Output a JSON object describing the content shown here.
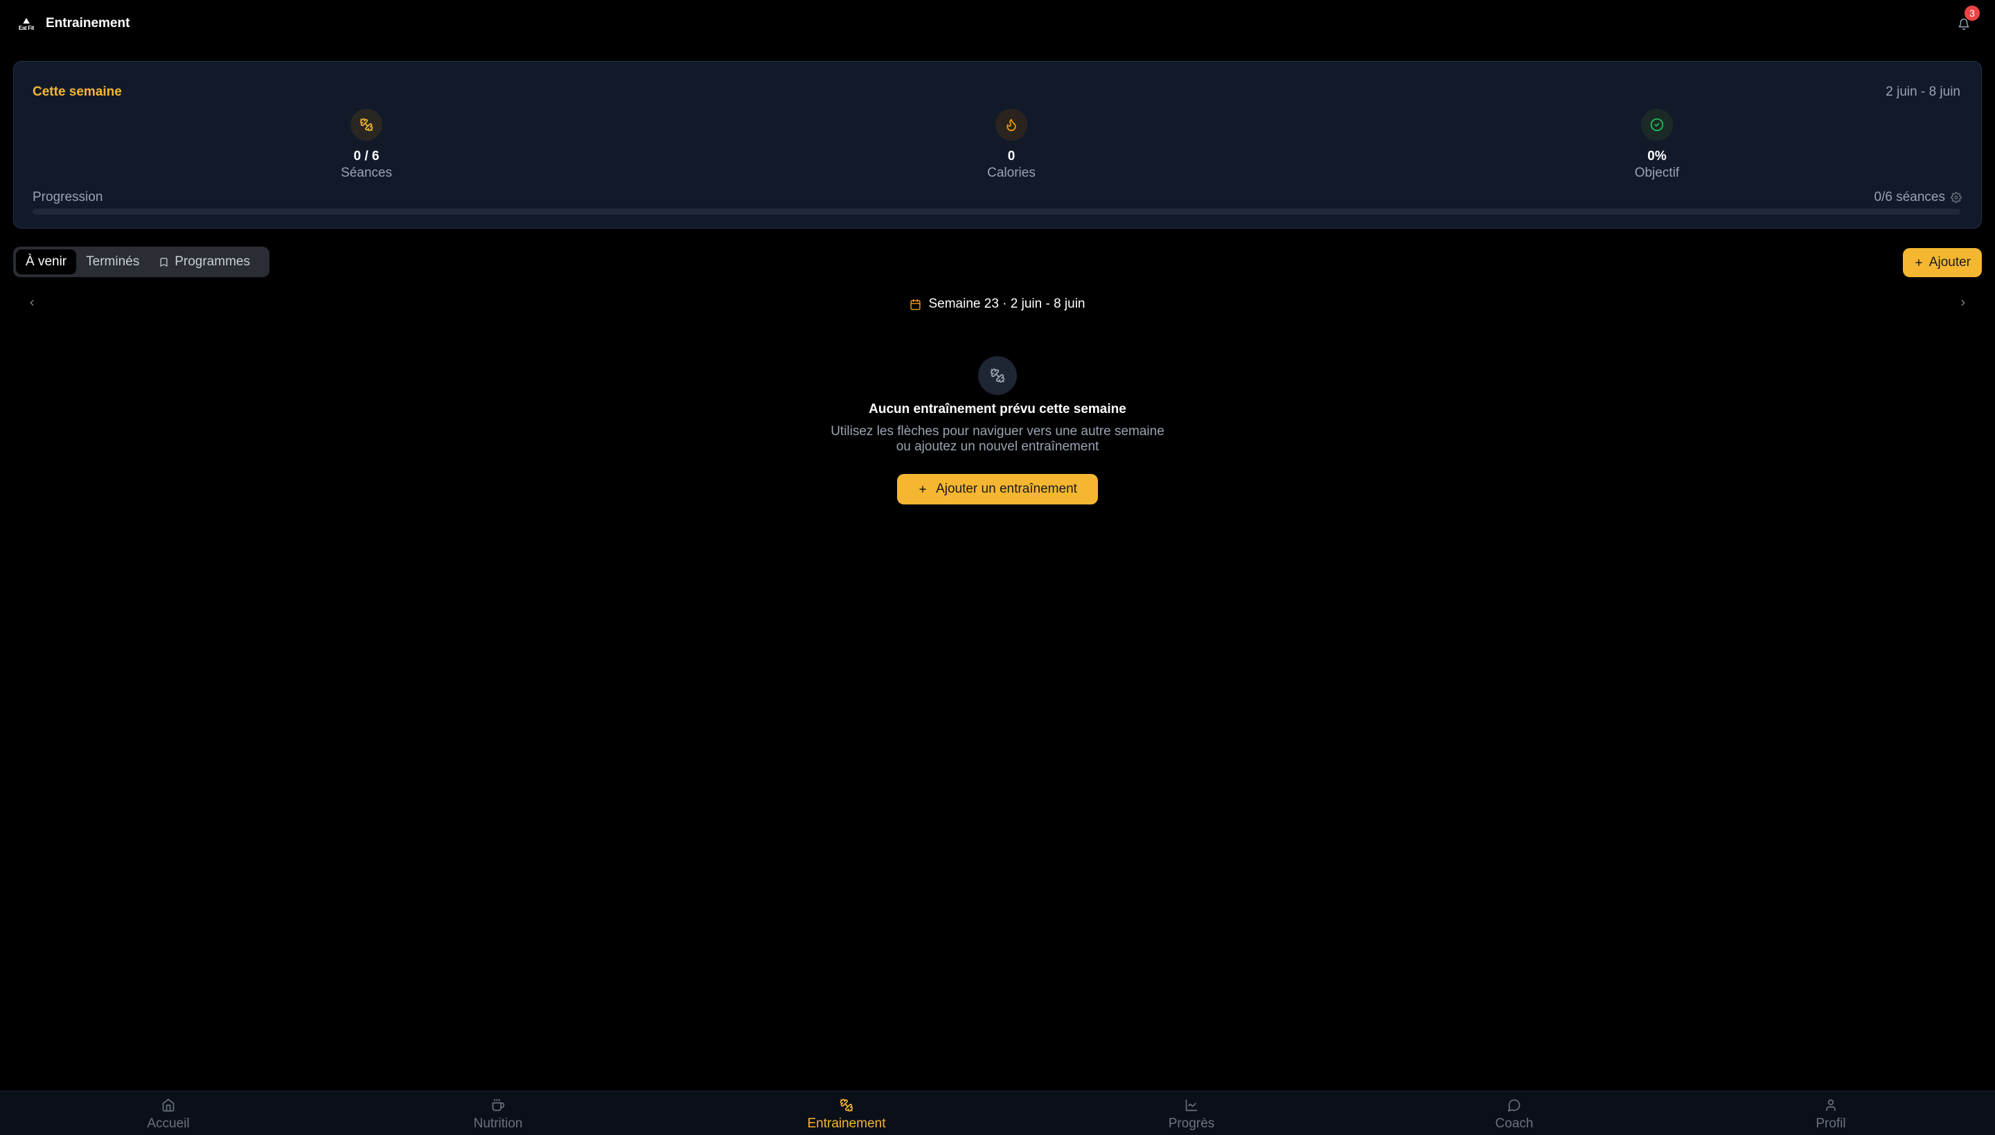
{
  "header": {
    "title": "Entrainement",
    "logo_text": "Eat Fit",
    "notification_count": "3"
  },
  "week_card": {
    "title": "Cette semaine",
    "range": "2 juin - 8 juin",
    "stats": [
      {
        "icon": "dumbbell-icon",
        "value": "0 / 6",
        "label": "Séances"
      },
      {
        "icon": "flame-icon",
        "value": "0",
        "label": "Calories"
      },
      {
        "icon": "check-circle-icon",
        "value": "0%",
        "label": "Objectif"
      }
    ],
    "progress_label": "Progression",
    "progress_text": "0/6 séances",
    "progress_fraction": 0
  },
  "tabs": [
    {
      "label": "À venir",
      "active": true
    },
    {
      "label": "Terminés",
      "active": false
    },
    {
      "label": "Programmes",
      "active": false
    }
  ],
  "add_button": "Ajouter",
  "week_nav": {
    "label": "Semaine 23 · 2 juin - 8 juin"
  },
  "empty_state": {
    "title": "Aucun entraînement prévu cette semaine",
    "line1": "Utilisez les flèches pour naviguer vers une autre semaine",
    "line2": "ou ajoutez un nouvel entraînement",
    "button": "Ajouter un entraînement"
  },
  "bottom_nav": [
    {
      "label": "Accueil",
      "icon": "home-icon",
      "active": false
    },
    {
      "label": "Nutrition",
      "icon": "cup-icon",
      "active": false
    },
    {
      "label": "Entrainement",
      "icon": "dumbbell-icon",
      "active": true
    },
    {
      "label": "Progrès",
      "icon": "chart-icon",
      "active": false
    },
    {
      "label": "Coach",
      "icon": "chat-icon",
      "active": false
    },
    {
      "label": "Profil",
      "icon": "user-icon",
      "active": false
    }
  ],
  "colors": {
    "accent": "#f5b731",
    "background": "#000000",
    "card": "#121a2a",
    "muted_text": "#9aa3b2",
    "badge": "#ef4444",
    "success": "#22c55e"
  }
}
